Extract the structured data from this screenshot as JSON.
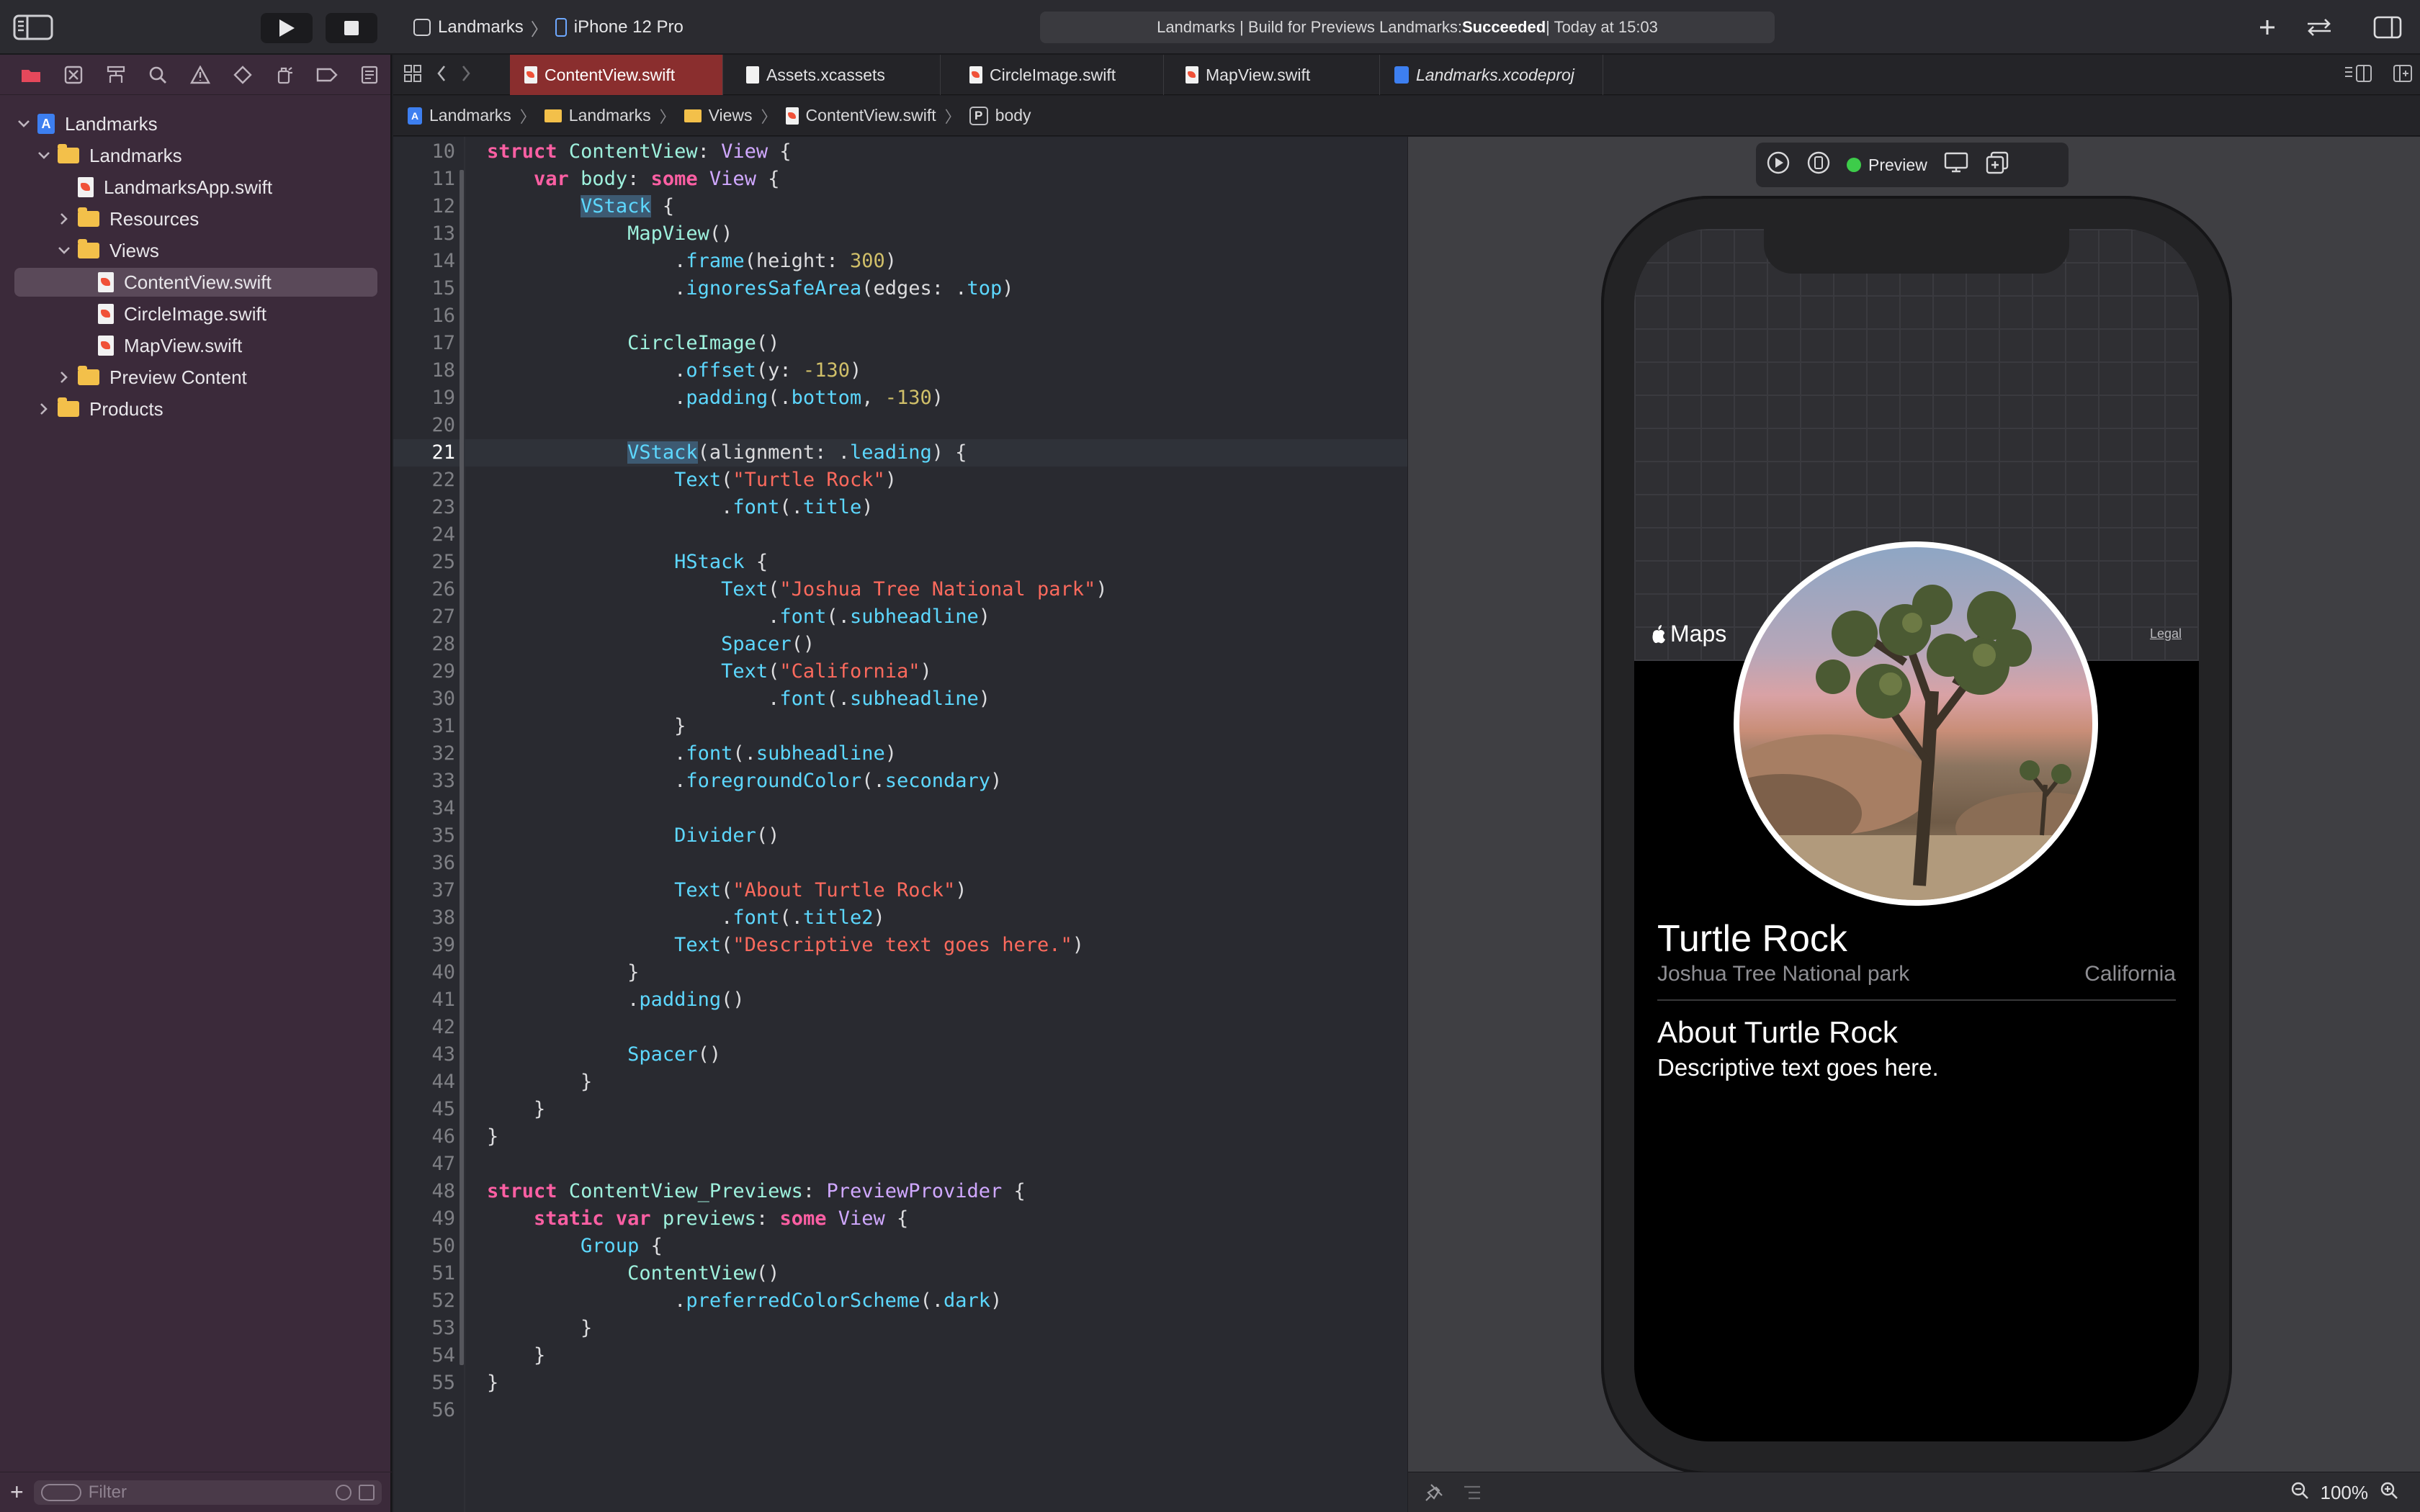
{
  "toolbar": {
    "scheme": {
      "target": "Landmarks",
      "device": "iPhone 12 Pro"
    },
    "status": {
      "prefix": "Landmarks | Build for Previews Landmarks: ",
      "result": "Succeeded",
      "suffix": " | Today at 15:03"
    }
  },
  "navigator": {
    "items": [
      {
        "label": "Landmarks",
        "kind": "project",
        "expanded": true
      },
      {
        "label": "Landmarks",
        "kind": "folder",
        "expanded": true
      },
      {
        "label": "LandmarksApp.swift",
        "kind": "swift"
      },
      {
        "label": "Resources",
        "kind": "folder",
        "expanded": false
      },
      {
        "label": "Views",
        "kind": "folder",
        "expanded": true
      },
      {
        "label": "ContentView.swift",
        "kind": "swift",
        "selected": true
      },
      {
        "label": "CircleImage.swift",
        "kind": "swift"
      },
      {
        "label": "MapView.swift",
        "kind": "swift"
      },
      {
        "label": "Preview Content",
        "kind": "folder",
        "expanded": false
      },
      {
        "label": "Products",
        "kind": "folder",
        "expanded": false
      }
    ],
    "filter_placeholder": "Filter"
  },
  "tabs": [
    {
      "label": "ContentView.swift",
      "active": true
    },
    {
      "label": "Assets.xcassets"
    },
    {
      "label": "CircleImage.swift"
    },
    {
      "label": "MapView.swift"
    },
    {
      "label": "Landmarks.xcodeproj"
    }
  ],
  "jumpbar": [
    "Landmarks",
    "Landmarks",
    "Views",
    "ContentView.swift",
    "body"
  ],
  "editor": {
    "current_line": 21,
    "lines": [
      {
        "n": "10",
        "text": "struct ContentView: View {"
      },
      {
        "n": "11",
        "text": "    var body: some View {"
      },
      {
        "n": "12",
        "text": "        VStack {"
      },
      {
        "n": "13",
        "text": "            MapView()"
      },
      {
        "n": "14",
        "text": "                .frame(height: 300)"
      },
      {
        "n": "15",
        "text": "                .ignoresSafeArea(edges: .top)"
      },
      {
        "n": "16",
        "text": ""
      },
      {
        "n": "17",
        "text": "            CircleImage()"
      },
      {
        "n": "18",
        "text": "                .offset(y: -130)"
      },
      {
        "n": "19",
        "text": "                .padding(.bottom, -130)"
      },
      {
        "n": "20",
        "text": ""
      },
      {
        "n": "21",
        "text": "            VStack(alignment: .leading) {"
      },
      {
        "n": "22",
        "text": "                Text(\"Turtle Rock\")"
      },
      {
        "n": "23",
        "text": "                    .font(.title)"
      },
      {
        "n": "24",
        "text": ""
      },
      {
        "n": "25",
        "text": "                HStack {"
      },
      {
        "n": "26",
        "text": "                    Text(\"Joshua Tree National park\")"
      },
      {
        "n": "27",
        "text": "                        .font(.subheadline)"
      },
      {
        "n": "28",
        "text": "                    Spacer()"
      },
      {
        "n": "29",
        "text": "                    Text(\"California\")"
      },
      {
        "n": "30",
        "text": "                        .font(.subheadline)"
      },
      {
        "n": "31",
        "text": "                }"
      },
      {
        "n": "32",
        "text": "                .font(.subheadline)"
      },
      {
        "n": "33",
        "text": "                .foregroundColor(.secondary)"
      },
      {
        "n": "34",
        "text": ""
      },
      {
        "n": "35",
        "text": "                Divider()"
      },
      {
        "n": "36",
        "text": ""
      },
      {
        "n": "37",
        "text": "                Text(\"About Turtle Rock\")"
      },
      {
        "n": "38",
        "text": "                    .font(.title2)"
      },
      {
        "n": "39",
        "text": "                Text(\"Descriptive text goes here.\")"
      },
      {
        "n": "40",
        "text": "            }"
      },
      {
        "n": "41",
        "text": "            .padding()"
      },
      {
        "n": "42",
        "text": ""
      },
      {
        "n": "43",
        "text": "            Spacer()"
      },
      {
        "n": "44",
        "text": "        }"
      },
      {
        "n": "45",
        "text": "    }"
      },
      {
        "n": "46",
        "text": "}"
      },
      {
        "n": "47",
        "text": ""
      },
      {
        "n": "48",
        "text": "struct ContentView_Previews: PreviewProvider {"
      },
      {
        "n": "49",
        "text": "    static var previews: some View {"
      },
      {
        "n": "50",
        "text": "        Group {"
      },
      {
        "n": "51",
        "text": "            ContentView()"
      },
      {
        "n": "52",
        "text": "                .preferredColorScheme(.dark)"
      },
      {
        "n": "53",
        "text": "        }"
      },
      {
        "n": "54",
        "text": "    }"
      },
      {
        "n": "55",
        "text": "}"
      },
      {
        "n": "56",
        "text": ""
      }
    ]
  },
  "preview": {
    "label": "Preview",
    "status_color": "#3dcc4a",
    "maps_label": "Maps",
    "legal_label": "Legal",
    "title": "Turtle Rock",
    "park": "Joshua Tree National park",
    "state": "California",
    "about_title": "About Turtle Rock",
    "about_desc": "Descriptive text goes here.",
    "zoom": "100%"
  },
  "colors": {
    "active_tab": "#8a2e2e",
    "navigator_bg": "#3b2a3a",
    "editor_bg": "#292a30"
  }
}
